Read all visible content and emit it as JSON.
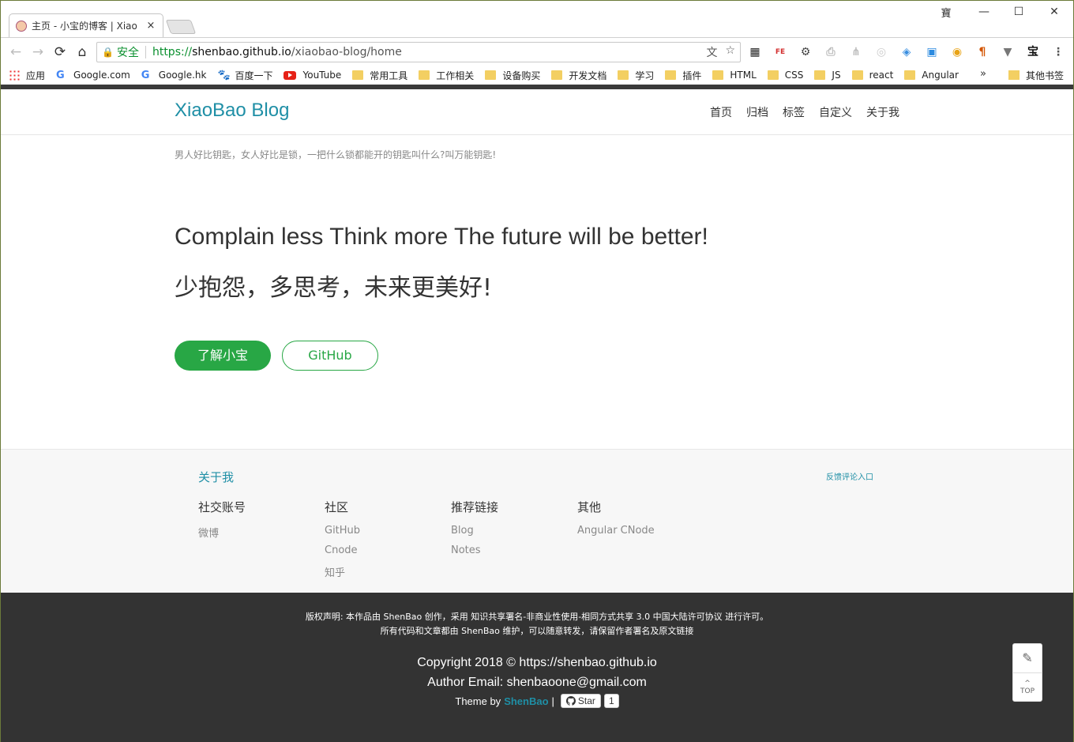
{
  "browser": {
    "tab": {
      "title": "主页 - 小宝的博客 | Xiao",
      "close": "×"
    },
    "window_controls": {
      "user": "寶",
      "minimize": "—",
      "maximize": "☐",
      "close": "✕"
    },
    "nav": {
      "back": "←",
      "forward": "→",
      "reload": "⟳",
      "home": "⌂"
    },
    "address": {
      "lock": "🔒",
      "security_label": "安全",
      "scheme": "https://",
      "host": "shenbao.github.io",
      "path": "/xiaobao-blog/home",
      "translate_icon": "文",
      "star_icon": "☆"
    },
    "extensions": [
      {
        "name": "qr-code-icon",
        "glyph": "▦",
        "color": "#222222"
      },
      {
        "name": "fe-helper-icon",
        "glyph": "FE",
        "color": "#d32f2f"
      },
      {
        "name": "tools-icon",
        "glyph": "⚙",
        "color": "#444444"
      },
      {
        "name": "pdf-icon",
        "glyph": "⎙",
        "color": "#bbbbbb"
      },
      {
        "name": "tree-icon",
        "glyph": "⋔",
        "color": "#bbbbbb"
      },
      {
        "name": "circle-ext-icon",
        "glyph": "◎",
        "color": "#cccccc"
      },
      {
        "name": "compass-icon",
        "glyph": "◈",
        "color": "#3b8fe0"
      },
      {
        "name": "window-ext-icon",
        "glyph": "▣",
        "color": "#2c8be0"
      },
      {
        "name": "chrome-ring-icon",
        "glyph": "◉",
        "color": "#e8a316"
      },
      {
        "name": "pilcrow-icon",
        "glyph": "¶",
        "color": "#d35400"
      },
      {
        "name": "vue-icon",
        "glyph": "▼",
        "color": "#777777"
      },
      {
        "name": "bao-icon",
        "glyph": "宝",
        "color": "#111111"
      },
      {
        "name": "menu-icon",
        "glyph": "⋮",
        "color": "#555555"
      }
    ],
    "bookmarks": [
      {
        "name": "apps",
        "label": "应用",
        "icon": "apps"
      },
      {
        "name": "google-com",
        "label": "Google.com",
        "icon": "g"
      },
      {
        "name": "google-hk",
        "label": "Google.hk",
        "icon": "g"
      },
      {
        "name": "baidu",
        "label": "百度一下",
        "icon": "paw"
      },
      {
        "name": "youtube",
        "label": "YouTube",
        "icon": "yt"
      },
      {
        "name": "common-tools",
        "label": "常用工具",
        "icon": "folder"
      },
      {
        "name": "work",
        "label": "工作相关",
        "icon": "folder"
      },
      {
        "name": "devices",
        "label": "设备购买",
        "icon": "folder"
      },
      {
        "name": "dev-docs",
        "label": "开发文档",
        "icon": "folder"
      },
      {
        "name": "study",
        "label": "学习",
        "icon": "folder"
      },
      {
        "name": "plugins",
        "label": "插件",
        "icon": "folder"
      },
      {
        "name": "html",
        "label": "HTML",
        "icon": "folder"
      },
      {
        "name": "css",
        "label": "CSS",
        "icon": "folder"
      },
      {
        "name": "js",
        "label": "JS",
        "icon": "folder"
      },
      {
        "name": "react",
        "label": "react",
        "icon": "folder"
      },
      {
        "name": "angular",
        "label": "Angular",
        "icon": "folder"
      }
    ],
    "bookmarks_more": "»",
    "other_bookmarks": "其他书签"
  },
  "site": {
    "brand": "XiaoBao Blog",
    "nav": [
      "首页",
      "归档",
      "标签",
      "自定义",
      "关于我"
    ],
    "motto": "男人好比钥匙，女人好比是锁，一把什么锁都能开的钥匙叫什么?叫万能钥匙!",
    "hero_en": "Complain less Think more The future will be better!",
    "hero_zh": "少抱怨，多思考，未来更美好!",
    "btn_about": "了解小宝",
    "btn_github": "GitHub",
    "about_me": "关于我",
    "feedback": "反馈评论入口",
    "columns": [
      {
        "title": "社交账号",
        "items": [
          "微博"
        ]
      },
      {
        "title": "社区",
        "items": [
          "GitHub",
          "Cnode",
          "知乎"
        ]
      },
      {
        "title": "推荐链接",
        "items": [
          "Blog",
          "Notes"
        ]
      },
      {
        "title": "其他",
        "items": [
          "Angular CNode"
        ]
      }
    ],
    "footer": {
      "license_line1": "版权声明: 本作品由 ShenBao 创作，采用 知识共享署名-非商业性使用-相同方式共享 3.0 中国大陆许可协议 进行许可。",
      "license_line2": "所有代码和文章都由 ShenBao 维护，可以随意转发，请保留作者署名及原文链接",
      "copyright": "Copyright 2018 © https://shenbao.github.io",
      "author_email": "Author Email: shenbaoone@gmail.com",
      "theme_by": "Theme by",
      "theme_author": "ShenBao",
      "divider": "|",
      "star_label": "Star",
      "star_count": "1"
    },
    "float": {
      "edit": "✎",
      "top_arrow": "^",
      "top_label": "TOP"
    }
  },
  "colors": {
    "accent": "#1f8fa6",
    "green": "#28a745",
    "footer_bg": "#333333"
  }
}
